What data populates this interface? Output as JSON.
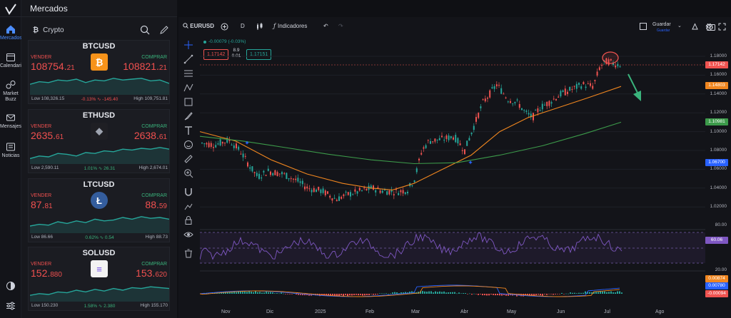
{
  "panel": {
    "title": "Mercados",
    "tab_label": "Crypto",
    "tab_glyph": "₿"
  },
  "rail": {
    "items": [
      {
        "label": "Mercados",
        "icon": "home-icon",
        "active": true
      },
      {
        "label": "Calendario",
        "icon": "calendar-icon"
      },
      {
        "label": "Market Buzz",
        "icon": "buzz-icon"
      },
      {
        "label": "Mensajes",
        "icon": "mail-icon"
      },
      {
        "label": "Noticias",
        "icon": "news-icon"
      }
    ]
  },
  "cards": [
    {
      "symbol": "BTCUSD",
      "sell_label": "VENDER",
      "buy_label": "COMPRAR",
      "sell_main": "108754.",
      "sell_small": "21",
      "buy_main": "108821.",
      "buy_small": "21",
      "low": "Low 108,326.15",
      "change": "-0.13% ∿ -145.40",
      "change_dir": "neg",
      "high": "High 109,751.81",
      "coin_color": "#f7931a",
      "coin_glyph": "₿",
      "spark": [
        0.55,
        0.4,
        0.45,
        0.3,
        0.35,
        0.25,
        0.45,
        0.3,
        0.35,
        0.2,
        0.3,
        0.25,
        0.2,
        0.35,
        0.3,
        0.5
      ]
    },
    {
      "symbol": "ETHUSD",
      "sell_label": "VENDER",
      "buy_label": "COMPRAR",
      "sell_main": "2635.",
      "sell_small": "61",
      "buy_main": "2638.",
      "buy_small": "61",
      "low": "Low 2,590.11",
      "change": "1.01% ∿ 26.31",
      "change_dir": "pos",
      "high": "High 2,674.01",
      "coin_color": "#1f1f24",
      "coin_glyph": "◆",
      "spark": [
        0.85,
        0.7,
        0.75,
        0.55,
        0.6,
        0.7,
        0.5,
        0.55,
        0.4,
        0.45,
        0.3,
        0.35,
        0.25,
        0.3,
        0.2,
        0.3
      ]
    },
    {
      "symbol": "LTCUSD",
      "sell_label": "VENDER",
      "buy_label": "COMPRAR",
      "sell_main": "87.",
      "sell_small": "81",
      "buy_main": "88.",
      "buy_small": "59",
      "low": "Low 86.66",
      "change": "0.62% ∿ 0.54",
      "change_dir": "pos",
      "high": "High 88.73",
      "coin_color": "#345d9d",
      "coin_glyph": "Ł",
      "spark": [
        0.75,
        0.65,
        0.7,
        0.5,
        0.6,
        0.45,
        0.55,
        0.35,
        0.45,
        0.4,
        0.25,
        0.35,
        0.2,
        0.3,
        0.25,
        0.35
      ]
    },
    {
      "symbol": "SOLUSD",
      "sell_label": "VENDER",
      "buy_label": "COMPRAR",
      "sell_main": "152.",
      "sell_small": "880",
      "buy_main": "153.",
      "buy_small": "620",
      "low": "Low 150.230",
      "change": "1.58% ∿ 2.380",
      "change_dir": "pos",
      "high": "High 155.170",
      "coin_color": "#f3f3f3",
      "coin_glyph": "≡",
      "spark": [
        0.8,
        0.7,
        0.75,
        0.6,
        0.65,
        0.5,
        0.6,
        0.45,
        0.55,
        0.4,
        0.5,
        0.35,
        0.4,
        0.3,
        0.35,
        0.4
      ]
    }
  ],
  "toolbar": {
    "symbol": "EURUSD",
    "interval": "D",
    "indicators_label": "Indicadores",
    "save_label": "Guardar",
    "save_sub": "Guardar"
  },
  "quote": {
    "change": "-0.00079 (-0.03%)",
    "sell": "1.17142",
    "spread_top": "8.9",
    "spread_bottom": "0.01",
    "buy": "1.17151"
  },
  "price_axis": [
    "1.18000",
    "1.16000",
    "1.14000",
    "1.12000",
    "1.10000",
    "1.08000",
    "1.06000",
    "1.04000",
    "1.02000"
  ],
  "price_tags": {
    "last": "1.17142",
    "ma_fast": "1.14803",
    "ma_slow": "1.10981",
    "cross": "1.06700"
  },
  "rsi_axis": [
    "80.00",
    "20.00"
  ],
  "rsi_tag": "60.06",
  "macd_tags": [
    "0.00874",
    "0.00780",
    "-0.00094"
  ],
  "months": [
    "Nov",
    "Dic",
    "2025",
    "Feb",
    "Mar",
    "Abr",
    "May",
    "Jun",
    "Jul",
    "Ago"
  ],
  "colors": {
    "up": "#26a69a",
    "down": "#ef5350",
    "ma_fast": "#f0861f",
    "ma_slow": "#3c9a4a",
    "rsi": "#7e57c2",
    "accent": "#2962ff"
  }
}
